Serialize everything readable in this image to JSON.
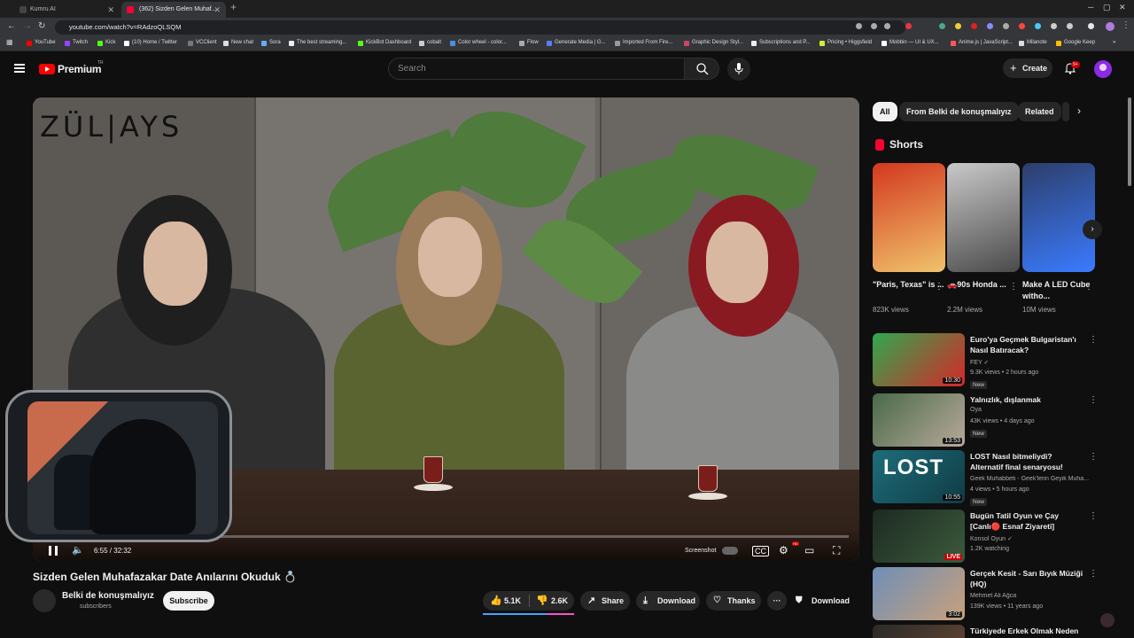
{
  "browser": {
    "tabs": [
      {
        "label": "Kumru AI",
        "active": false
      },
      {
        "label": "(362) Sizden Gelen Muhaf...",
        "active": true
      }
    ],
    "url": "youtube.com/watch?v=RAdzoQLSQM",
    "bookmarks": [
      "YouTube",
      "Twitch",
      "Kick",
      "(10) Home / Twitter",
      "VCClient",
      "New chat",
      "Sora",
      "The best streaming...",
      "KickBot Dashboard",
      "cobalt",
      "Color wheel - color...",
      "Flow",
      "Generate Media | G...",
      "Imported From Fire...",
      "Graphic Design Styl...",
      "Subscriptions and P...",
      "Pricing • Higgsfield",
      "Mobbin — UI & UX...",
      "Anime.js | JavaScript...",
      "Milanote",
      "Google Keep"
    ]
  },
  "header": {
    "logo": "Premium",
    "region": "TR",
    "search_placeholder": "Search",
    "create_label": "Create",
    "notif_count": "9+"
  },
  "player": {
    "watermark": "ZÜL|AYS",
    "current_time": "6:55 / 32:32",
    "progress": 0.213,
    "screenshot_label": "Screenshot"
  },
  "video": {
    "title": "Sizden Gelen Muhafazakar Date Anılarını Okuduk 💍",
    "channel": "Belki de konuşmalıyız",
    "subscribers": "subscribers",
    "subscribe_label": "Subscribe",
    "likes": "5.1K",
    "dislikes": "2.6K",
    "share": "Share",
    "download": "Download",
    "thanks": "Thanks",
    "download2": "Download"
  },
  "sidebar": {
    "chips": [
      "All",
      "From Belki de konuşmalıyız",
      "Related"
    ],
    "shorts_title": "Shorts",
    "shorts": [
      {
        "title": "\"Paris, Texas\" is ...",
        "views": "823K views",
        "color1": "#d3381f",
        "color2": "#f0c36b"
      },
      {
        "title": "🚗90s Honda ...",
        "views": "2.2M views",
        "color1": "#c9c9c9",
        "color2": "#4a4a4a"
      },
      {
        "title": "Make A LED Cube witho...",
        "views": "10M views",
        "color1": "#2d3e6b",
        "color2": "#3a7bff"
      }
    ],
    "recommendations": [
      {
        "title": "Euro'ya Geçmek Bulgaristan'ı Nasıl Batıracak?",
        "channel": "FEY ✓",
        "meta": "9.3K views • 2 hours ago",
        "badge": "New",
        "duration": "10:30",
        "color1": "#2fa84f",
        "color2": "#d62828"
      },
      {
        "title": "Yalnızlık, dışlanmak",
        "channel": "Oya",
        "meta": "43K views • 4 days ago",
        "badge": "New",
        "duration": "13:53",
        "color1": "#4a6a48",
        "color2": "#b7a99a"
      },
      {
        "title": "LOST Nasıl bitmeliydi? Alternatif final senaryosu!",
        "channel": "Geek Muhabbeti - Geek'lerin Geyik Muha...",
        "meta": "4 views • 5 hours ago",
        "badge": "New",
        "duration": "10:55",
        "color1": "#1e6d7a",
        "color2": "#0f3c45"
      },
      {
        "title": "Bugün Tatil Oyun ve Çay [Canlı🔴 Esnaf Ziyareti]",
        "channel": "Konsol Oyun ✓",
        "meta": "1.2K watching",
        "badge": "",
        "duration": "LIVE",
        "color1": "#1d2a22",
        "color2": "#3b5a3c"
      },
      {
        "title": "Gerçek Kesit - Sarı Bıyık Müziği (HQ)",
        "channel": "Mehmet Ali Ağca",
        "meta": "139K views • 11 years ago",
        "badge": "",
        "duration": "3:02",
        "color1": "#6e8fb8",
        "color2": "#c9a07a"
      },
      {
        "title": "Türkiyede Erkek Olmak Neden",
        "channel": "",
        "meta": "",
        "badge": "",
        "duration": "",
        "color1": "#2a2a2a",
        "color2": "#5a4030"
      }
    ]
  }
}
